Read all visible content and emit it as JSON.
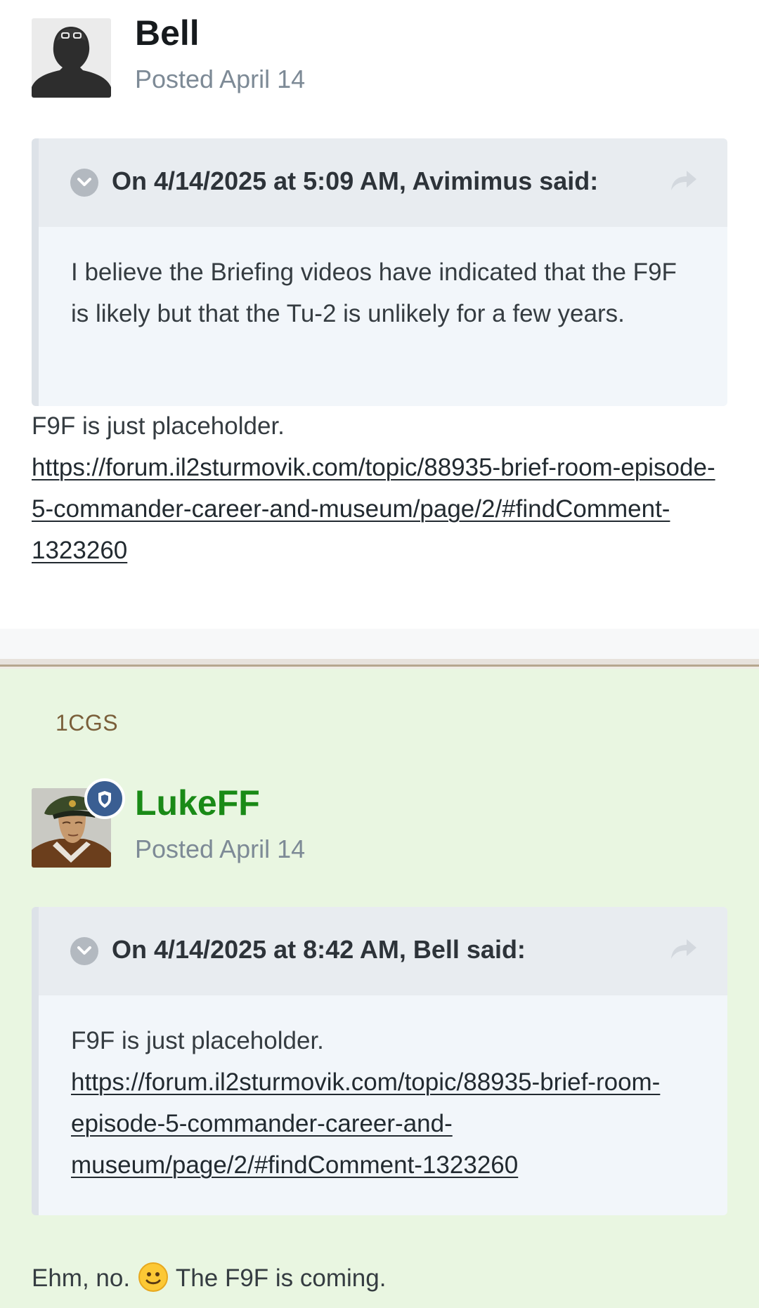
{
  "post1": {
    "author": "Bell",
    "posted": "Posted April 14",
    "quote": {
      "cite": "On 4/14/2025 at 5:09 AM, Avimimus said:",
      "text": "I believe the Briefing videos have indicated that the F9F is likely but that the Tu-2 is unlikely for a few years."
    },
    "body_text": "F9F is just placeholder.",
    "link_text": "https://forum.il2sturmovik.com/topic/88935-brief-room-episode-5-commander-career-and-museum/page/2/#findComment-1323260"
  },
  "post2": {
    "badge_label": "1CGS",
    "author": "LukeFF",
    "posted": "Posted April 14",
    "quote": {
      "cite": "On 4/14/2025 at 8:42 AM, Bell said:",
      "text": "F9F is just placeholder.",
      "link_text": "https://forum.il2sturmovik.com/topic/88935-brief-room-episode-5-commander-career-and-museum/page/2/#findComment-1323260"
    },
    "body_before_emoji": "Ehm, no.",
    "body_after_emoji": "The F9F is coming."
  },
  "colors": {
    "author_moderator": "#1a8a17",
    "post2_background": "#e9f6e1",
    "badge_label": "#7a5f3a",
    "mod_badge": "#3a5e92"
  },
  "icons": {
    "avatar_bell": "pilot-silhouette-avatar",
    "avatar_lukeff": "officer-portrait-avatar",
    "quote_toggle": "chevron-down-icon",
    "quote_share": "share-arrow-icon",
    "mod_badge": "shield-icon",
    "emoji": "slightly-smiling-face-emoji"
  }
}
